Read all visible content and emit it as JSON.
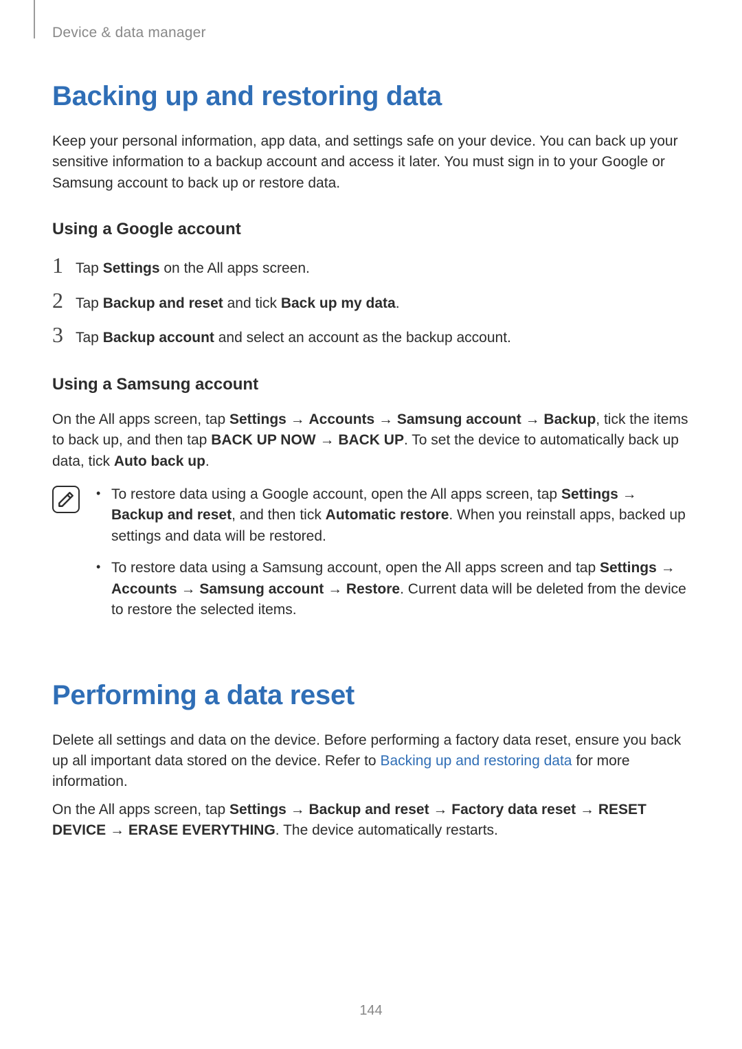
{
  "header": {
    "running_title": "Device & data manager"
  },
  "section1": {
    "title": "Backing up and restoring data",
    "intro": "Keep your personal information, app data, and settings safe on your device. You can back up your sensitive information to a backup account and access it later. You must sign in to your Google or Samsung account to back up or restore data.",
    "sub1": {
      "title": "Using a Google account",
      "steps": [
        {
          "n": "1",
          "pre": "Tap ",
          "b1": "Settings",
          "post": " on the All apps screen."
        },
        {
          "n": "2",
          "pre": "Tap ",
          "b1": "Backup and reset",
          "mid": " and tick ",
          "b2": "Back up my data",
          "post": "."
        },
        {
          "n": "3",
          "pre": "Tap ",
          "b1": "Backup account",
          "post": " and select an account as the backup account."
        }
      ]
    },
    "sub2": {
      "title": "Using a Samsung account",
      "para": {
        "t1": "On the All apps screen, tap ",
        "b1": "Settings",
        "t2": " → ",
        "b2": "Accounts",
        "t3": " → ",
        "b3": "Samsung account",
        "t4": " → ",
        "b4": "Backup",
        "t5": ", tick the items to back up, and then tap ",
        "b5": "BACK UP NOW",
        "t6": " → ",
        "b6": "BACK UP",
        "t7": ". To set the device to automatically back up data, tick ",
        "b7": "Auto back up",
        "t8": "."
      },
      "notes": [
        {
          "t1": "To restore data using a Google account, open the All apps screen, tap ",
          "b1": "Settings",
          "t2": " → ",
          "b2": "Backup and reset",
          "t3": ", and then tick ",
          "b3": "Automatic restore",
          "t4": ". When you reinstall apps, backed up settings and data will be restored."
        },
        {
          "t1": "To restore data using a Samsung account, open the All apps screen and tap ",
          "b1": "Settings",
          "t2": " → ",
          "b2": "Accounts",
          "t3": " → ",
          "b3": "Samsung account",
          "t4": " → ",
          "b4": "Restore",
          "t5": ". Current data will be deleted from the device to restore the selected items."
        }
      ]
    }
  },
  "section2": {
    "title": "Performing a data reset",
    "para1": {
      "t1": "Delete all settings and data on the device. Before performing a factory data reset, ensure you back up all important data stored on the device. Refer to ",
      "link": "Backing up and restoring data",
      "t2": " for more information."
    },
    "para2": {
      "t1": "On the All apps screen, tap ",
      "b1": "Settings",
      "t2": " → ",
      "b2": "Backup and reset",
      "t3": " → ",
      "b3": "Factory data reset",
      "t4": " → ",
      "b4": "RESET DEVICE",
      "t5": " → ",
      "b5": "ERASE EVERYTHING",
      "t6": ". The device automatically restarts."
    }
  },
  "page_number": "144"
}
